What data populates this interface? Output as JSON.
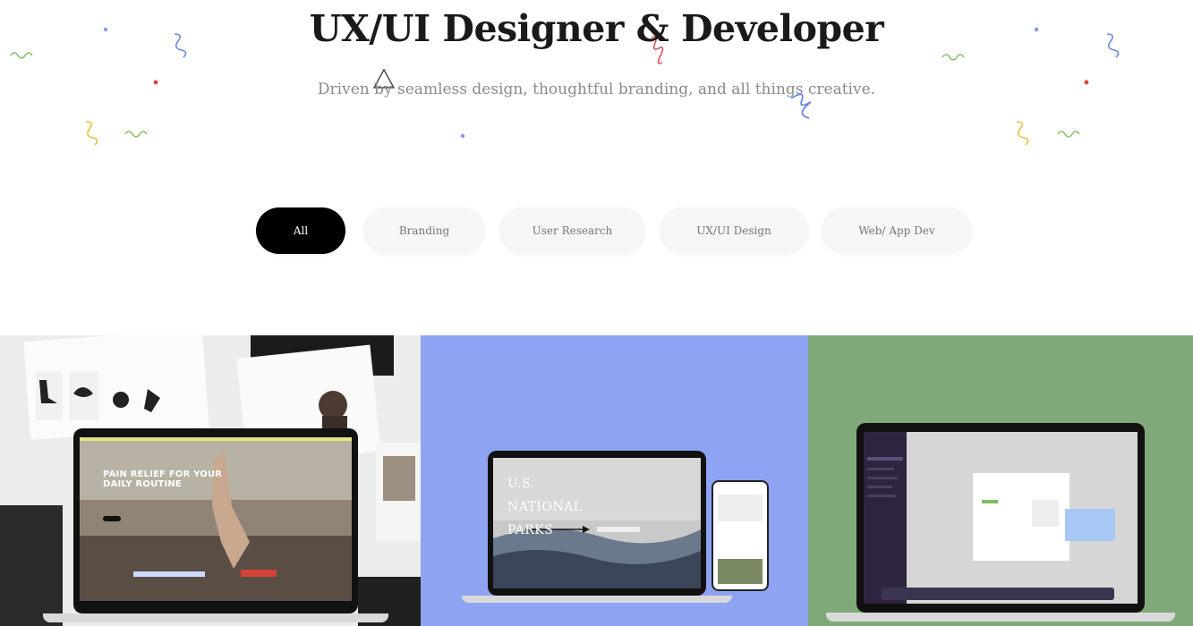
{
  "hero": {
    "title": "UX/UI Designer & Developer",
    "subtitle": "Driven by seamless design, thoughtful branding, and all things creative."
  },
  "filters": [
    {
      "label": "All",
      "active": true
    },
    {
      "label": "Branding",
      "active": false
    },
    {
      "label": "User Research",
      "active": false
    },
    {
      "label": "UX/UI Design",
      "active": false
    },
    {
      "label": "Web/ App Dev",
      "active": false
    }
  ],
  "projects": [
    {
      "headline": "PAIN RELIEF FOR YOUR DAILY ROUTINE",
      "background": "#ececea"
    },
    {
      "headline": "U.S. NATIONAL PARKS",
      "background": "#8ea3f2"
    },
    {
      "headline": "",
      "background": "#7fa978"
    }
  ],
  "colors": {
    "accent": "#000000",
    "pill_bg": "#f6f6f4"
  }
}
